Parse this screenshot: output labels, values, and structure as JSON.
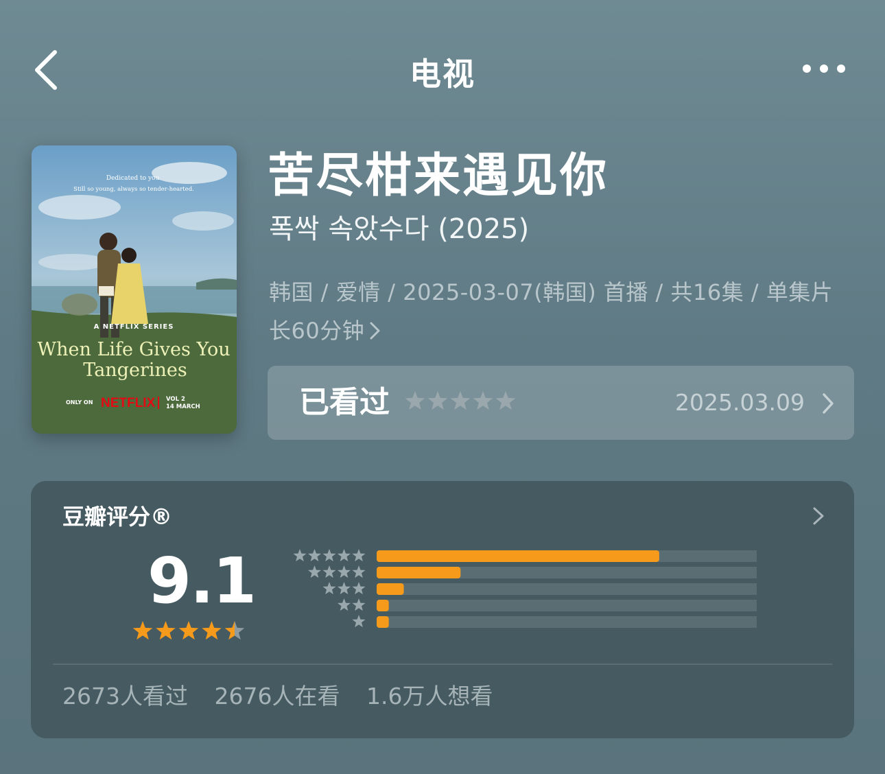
{
  "nav": {
    "title": "电视",
    "back_icon": "chevron-left-icon",
    "more_icon": "more-dots-icon"
  },
  "poster": {
    "dedication_line1": "Dedicated to you.",
    "dedication_line2": "Still so young, always so tender-hearted.",
    "series_tag": "A NETFLIX SERIES",
    "film_title_line1": "When Life Gives You",
    "film_title_line2": "Tangerines",
    "only_on": "ONLY ON",
    "brand": "NETFLIX",
    "vol": "VOL 2",
    "release": "14 MARCH"
  },
  "info": {
    "title": "苦尽柑来遇见你",
    "original_title": "폭싹 속았수다 (2025)",
    "meta_line1": "韩国 / 爱情 / 2025-03-07(韩国) 首播 / 共16集 / 单集片",
    "meta_line2": "长60分钟"
  },
  "watched": {
    "label": "已看过",
    "date": "2025.03.09",
    "user_rating_stars": 0
  },
  "rating": {
    "title": "豆瓣评分®",
    "score": "9.1",
    "stars": 4.5,
    "distribution": [
      {
        "stars": 5,
        "fraction": 0.697
      },
      {
        "stars": 4,
        "fraction": 0.207
      },
      {
        "stars": 3,
        "fraction": 0.067
      },
      {
        "stars": 2,
        "fraction": 0.03
      },
      {
        "stars": 1,
        "fraction": 0.03
      }
    ],
    "stats": [
      "2673人看过",
      "2676人在看",
      "1.6万人想看"
    ]
  },
  "colors": {
    "accent_orange": "#f59a1b",
    "bar_track": "#5a6d73",
    "card_bg": "#465a61",
    "star_grey": "#9aa8ad"
  }
}
